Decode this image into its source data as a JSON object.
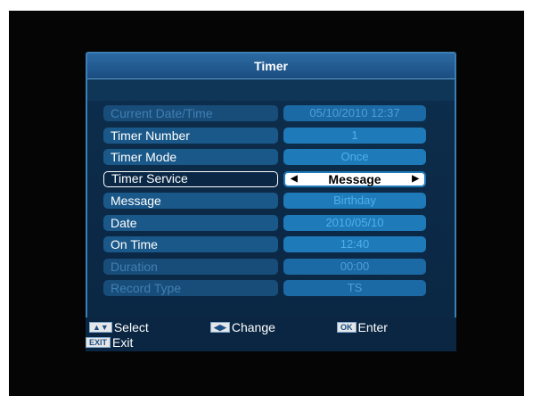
{
  "dialog": {
    "title": "Timer"
  },
  "rows": [
    {
      "label": "Current Date/Time",
      "value": "05/10/2010 12:37"
    },
    {
      "label": "Timer Number",
      "value": "1"
    },
    {
      "label": "Timer Mode",
      "value": "Once"
    },
    {
      "label": "Timer Service",
      "value": "Message"
    },
    {
      "label": "Message",
      "value": "Birthday"
    },
    {
      "label": "Date",
      "value": "2010/05/10"
    },
    {
      "label": "On Time",
      "value": "12:40"
    },
    {
      "label": "Duration",
      "value": "00:00"
    },
    {
      "label": "Record Type",
      "value": "TS"
    }
  ],
  "help": {
    "select": "Select",
    "change": "Change",
    "enter": "Enter",
    "exit": "Exit",
    "ok_key": "OK",
    "exit_key": "EXIT"
  },
  "colors": {
    "panel": "#0a2642",
    "title_bar": "#2c6aa3",
    "label_cell": "#1a5889",
    "value_cell": "#1f7ab9",
    "focus_value": "#ffffff"
  }
}
